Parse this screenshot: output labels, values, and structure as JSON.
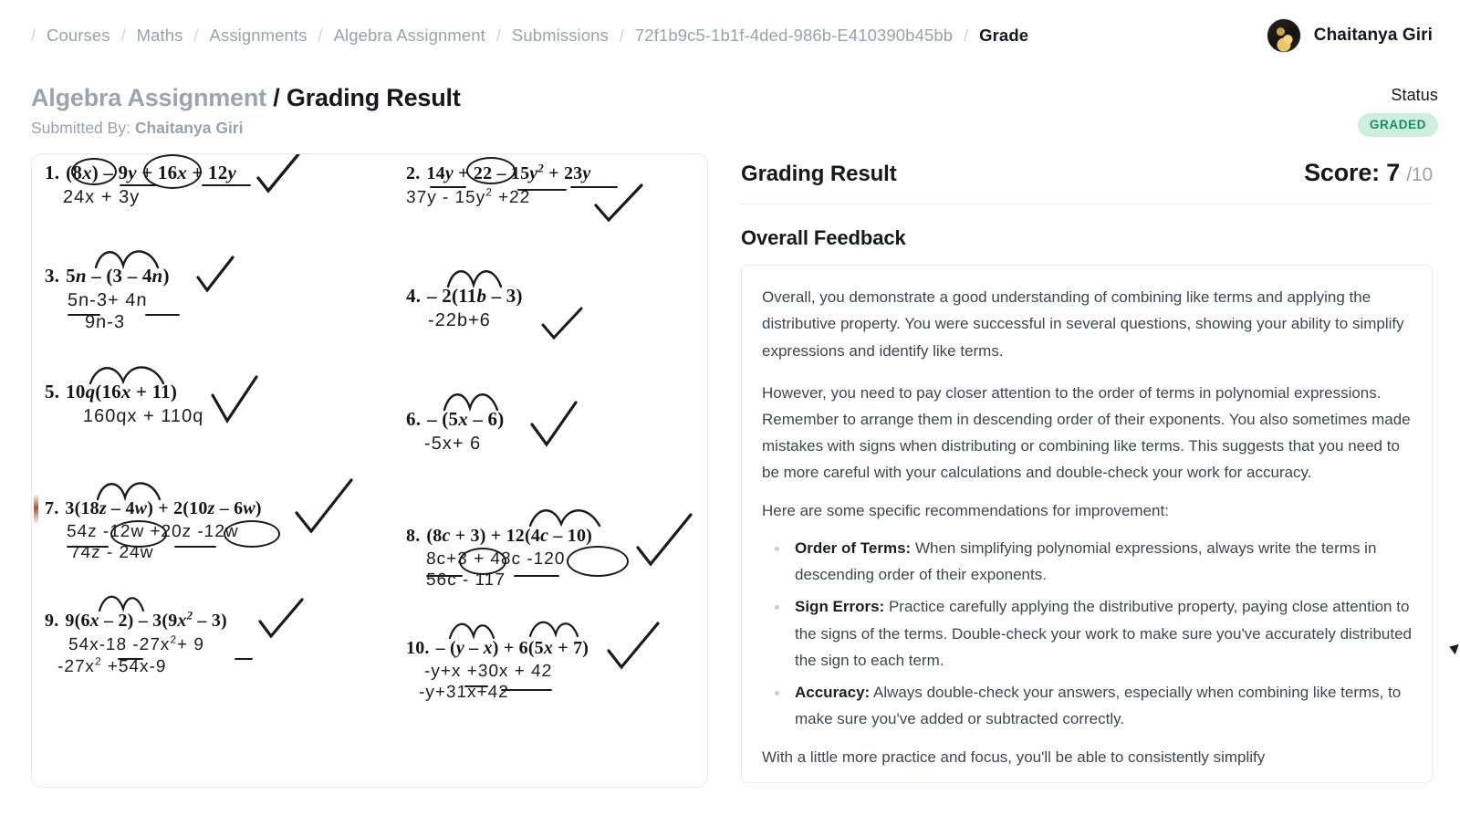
{
  "breadcrumb": {
    "items": [
      {
        "label": "Courses",
        "current": false
      },
      {
        "label": "Maths",
        "current": false
      },
      {
        "label": "Assignments",
        "current": false
      },
      {
        "label": "Algebra Assignment",
        "current": false
      },
      {
        "label": "Submissions",
        "current": false
      },
      {
        "label": "72f1b9c5-1b1f-4ded-986b-E410390b45bb",
        "current": false
      },
      {
        "label": "Grade",
        "current": true
      }
    ],
    "separator": "/"
  },
  "user": {
    "name": "Chaitanya Giri",
    "avatar_icon": "user-avatar-photo"
  },
  "header": {
    "assignment": "Algebra Assignment",
    "separator": "/",
    "page": "Grading Result",
    "submitted_by_label": "Submitted By:",
    "submitted_by_name": "Chaitanya Giri",
    "status_label": "Status",
    "status_value": "GRADED",
    "status_color": "#1f8a5a",
    "status_bg": "#cdf0dd"
  },
  "grading": {
    "title": "Grading Result",
    "score_label": "Score:",
    "score": "7",
    "score_divider": "/",
    "score_total": "10",
    "feedback_heading": "Overall Feedback",
    "paragraphs": [
      "Overall, you demonstrate a good understanding of combining like terms and applying the distributive property. You were successful in several questions, showing your ability to simplify expressions and identify like terms.",
      "However, you need to pay closer attention to the order of terms in polynomial expressions. Remember to arrange them in descending order of their exponents. You also sometimes made mistakes with signs when distributing or combining like terms. This suggests that you need to be more careful with your calculations and double-check your work for accuracy."
    ],
    "list_intro": "Here are some specific recommendations for improvement:",
    "recommendations": [
      {
        "title": "Order of Terms:",
        "text": " When simplifying polynomial expressions, always write the terms in descending order of their exponents."
      },
      {
        "title": "Sign Errors:",
        "text": " Practice carefully applying the distributive property, paying close attention to the signs of the terms. Double-check your work to make sure you've accurately distributed the sign to each term."
      },
      {
        "title": "Accuracy:",
        "text": " Always double-check your answers, especially when combining like terms, to make sure you've added or subtracted correctly."
      }
    ],
    "closing": "With a little more practice and focus, you'll be able to consistently simplify"
  },
  "worksheet": {
    "problems": [
      {
        "num": "1.",
        "question_html": "(8<i>x</i>) &ndash; 9<i>y</i> + 16<i>x</i> + 12<i>y</i>",
        "answer_html": "24x + 3y",
        "checked": true
      },
      {
        "num": "2.",
        "question_html": "14<i>y</i> + 22 &ndash; 15<i>y</i><sup>2</sup> + 23<i>y</i>",
        "answer_html": "37y - 15y<sup>2</sup> +22",
        "checked": true
      },
      {
        "num": "3.",
        "question_html": "5<i>n</i> &ndash; (3 &ndash; 4<i>n</i>)",
        "answer_html": "5n-3+ 4n",
        "answer2_html": "9n-3",
        "checked": true
      },
      {
        "num": "4.",
        "question_html": "&ndash; 2(11<i>b</i> &ndash; 3)",
        "answer_html": "-22b+6",
        "checked": true
      },
      {
        "num": "5.",
        "question_html": "10<i>q</i>(16<i>x</i> + 11)",
        "answer_html": "160qx + 110q",
        "checked": true
      },
      {
        "num": "6.",
        "question_html": "&ndash; (5<i>x</i> &ndash; 6)",
        "answer_html": "-5x+ 6",
        "checked": true
      },
      {
        "num": "7.",
        "question_html": "3(18<i>z</i> &ndash; 4<i>w</i>) + 2(10<i>z</i> &ndash; 6<i>w</i>)",
        "answer_html": "54z -12w +20z -12w",
        "answer2_html": "74z - 24w",
        "checked": true
      },
      {
        "num": "8.",
        "question_html": "(8<i>c</i> + 3) + 12(4<i>c</i> &ndash; 10)",
        "answer_html": "8c+3 + 48c -120",
        "answer2_html": "56c - 117",
        "checked": true
      },
      {
        "num": "9.",
        "question_html": "9(6<i>x</i> &ndash; 2) &ndash; 3(9<i>x</i><sup>2</sup> &ndash; 3)",
        "answer_html": "54x-18 -27x<sup>2</sup>+ 9",
        "answer2_html": "-27x<sup>2</sup> +54x-9",
        "checked": true
      },
      {
        "num": "10.",
        "question_html": "&ndash; (<i>y</i> &ndash; <i>x</i>) + 6(5<i>x</i> + 7)",
        "answer_html": "-y+x +30x + 42",
        "answer2_html": "-y+31x+42",
        "checked": true
      }
    ]
  }
}
